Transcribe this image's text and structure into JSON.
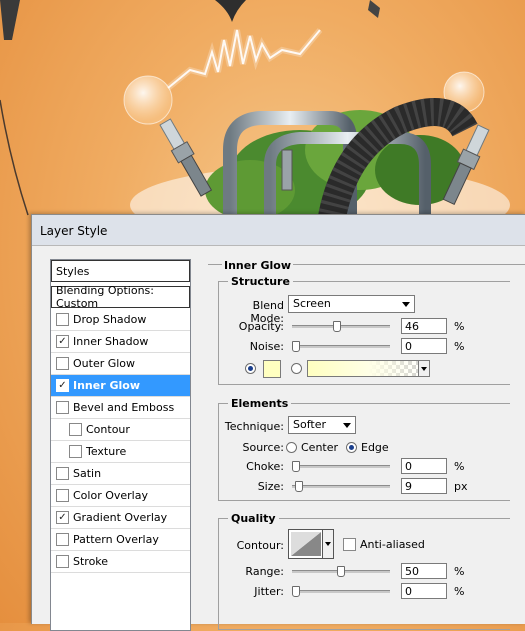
{
  "dialog": {
    "title": "Layer Style"
  },
  "styles_panel": {
    "header": "Styles",
    "blending": "Blending Options: Custom",
    "items": [
      {
        "label": "Drop Shadow",
        "checked": false
      },
      {
        "label": "Inner Shadow",
        "checked": true
      },
      {
        "label": "Outer Glow",
        "checked": false
      },
      {
        "label": "Inner Glow",
        "checked": true,
        "selected": true
      },
      {
        "label": "Bevel and Emboss",
        "checked": false
      },
      {
        "label": "Contour",
        "checked": false,
        "sub": true
      },
      {
        "label": "Texture",
        "checked": false,
        "sub": true
      },
      {
        "label": "Satin",
        "checked": false
      },
      {
        "label": "Color Overlay",
        "checked": false
      },
      {
        "label": "Gradient Overlay",
        "checked": true
      },
      {
        "label": "Pattern Overlay",
        "checked": false
      },
      {
        "label": "Stroke",
        "checked": false
      }
    ]
  },
  "inner_glow": {
    "title": "Inner Glow",
    "structure": {
      "title": "Structure",
      "blend_mode_label": "Blend Mode:",
      "blend_mode": "Screen",
      "opacity_label": "Opacity:",
      "opacity": "46",
      "opacity_value": 46,
      "noise_label": "Noise:",
      "noise": "0",
      "noise_value": 0,
      "percent": "%",
      "glow_color": "#ffffc0"
    },
    "elements": {
      "title": "Elements",
      "technique_label": "Technique:",
      "technique": "Softer",
      "source_label": "Source:",
      "source_center": "Center",
      "source_edge": "Edge",
      "choke_label": "Choke:",
      "choke": "0",
      "choke_value": 0,
      "size_label": "Size:",
      "size": "9",
      "size_value": 9,
      "px": "px",
      "percent": "%"
    },
    "quality": {
      "title": "Quality",
      "contour_label": "Contour:",
      "anti_aliased_label": "Anti-aliased",
      "range_label": "Range:",
      "range": "50",
      "range_value": 50,
      "jitter_label": "Jitter:",
      "jitter": "0",
      "jitter_value": 0,
      "percent": "%"
    }
  }
}
